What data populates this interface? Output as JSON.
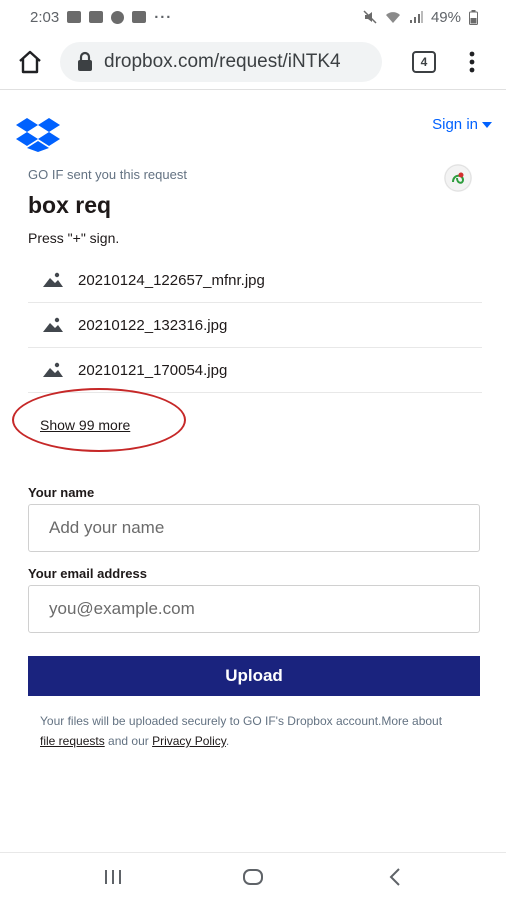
{
  "status_bar": {
    "time": "2:03",
    "battery": "49%",
    "overflow": "···"
  },
  "browser": {
    "url": "dropbox.com/request/iNTK4",
    "tab_count": "4"
  },
  "header": {
    "sign_in": "Sign in"
  },
  "request": {
    "sender_line": "GO IF sent you this request",
    "title": "box req",
    "description": "Press \"+\" sign."
  },
  "files": [
    {
      "name": "20210124_122657_mfnr.jpg"
    },
    {
      "name": "20210122_132316.jpg"
    },
    {
      "name": "20210121_170054.jpg"
    }
  ],
  "show_more": "Show 99 more",
  "form": {
    "name_label": "Your name",
    "name_placeholder": "Add your name",
    "email_label": "Your email address",
    "email_placeholder": "you@example.com",
    "upload_label": "Upload"
  },
  "footer": {
    "text_before": "Your files will be uploaded securely to GO IF's Dropbox account.More about ",
    "link_file_requests": "file requests",
    "text_middle": " and our ",
    "link_privacy": "Privacy Policy",
    "text_after": "."
  },
  "colors": {
    "accent": "#0061fe",
    "upload_button": "#1a237e",
    "annotation_circle": "#c62828"
  },
  "icons": [
    "home-icon",
    "lock-icon",
    "tabs-icon",
    "more-vert-icon",
    "dropbox-logo",
    "image-file-icon",
    "recents-icon",
    "home-nav-icon",
    "back-icon"
  ]
}
